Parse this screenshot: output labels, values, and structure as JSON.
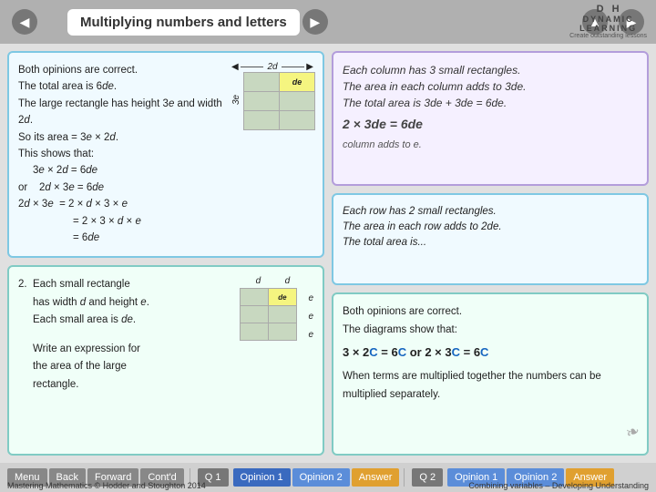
{
  "title": "Multiplying numbers and letters",
  "logo": {
    "line1": "DYNAMIC",
    "line2": "LEARNING",
    "line3": "Create outstanding lessons"
  },
  "left_top_card": {
    "text_lines": [
      "Both opinions are correct.",
      "The total area is 6de.",
      "The large rectangle has height 3e and width",
      "2d.",
      "So its area = 3e × 2d.",
      "This shows that:",
      "    3e × 2d = 6de",
      "or    2d × 3e = 6de",
      "2d × 3e  = 2 × d × 3 × e",
      "    = 2 × 3 × d × e",
      "    = 6de"
    ],
    "grid_label_top": "2d",
    "grid_label_side": "3e",
    "grid_cell_label": "de"
  },
  "left_bottom_card": {
    "text_lines": [
      "2.  Each small rectangle",
      "     has width d and height e.",
      "     Each small area is de.",
      "",
      "     Write an expression for",
      "     the area of the large",
      "     rectangle."
    ],
    "grid_label_top1": "d",
    "grid_label_top2": "d",
    "grid_cell_label": "de"
  },
  "right_top_card": {
    "text_lines": [
      "Each column has 3 small rectangles.",
      "The area in each column adds to 3de.",
      "The total area is 3de + 3de = 6de."
    ],
    "equation": "2 × 3de = 6de",
    "subtext": "column adds to e."
  },
  "right_mid_card": {
    "text_lines": [
      "Each row has 2 small rectangles.",
      "The area in each row adds to 2de.",
      "The total area is..."
    ]
  },
  "right_bottom_card": {
    "text_lines": [
      "Both opinions are correct.",
      "The diagrams show that:"
    ],
    "equation": "3 × 2C = 6C or 2 × 3C = 6C",
    "extra": "When terms are multiplied together the numbers can be multiplied separately."
  },
  "bottom_bar": {
    "menu": "Menu",
    "back": "Back",
    "forward": "Forward",
    "contd": "Cont'd",
    "q1": "Q 1",
    "opinion1": "Opinion 1",
    "opinion2": "Opinion 2",
    "answer": "Answer",
    "q2": "Q 2",
    "opinion1_2": "Opinion 1",
    "opinion2_2": "Opinion 2",
    "answer2": "Answer",
    "footer_left": "Mastering Mathematics © Hodder and Stoughton 2014",
    "footer_right": "Combining variables – Developing Understanding"
  }
}
